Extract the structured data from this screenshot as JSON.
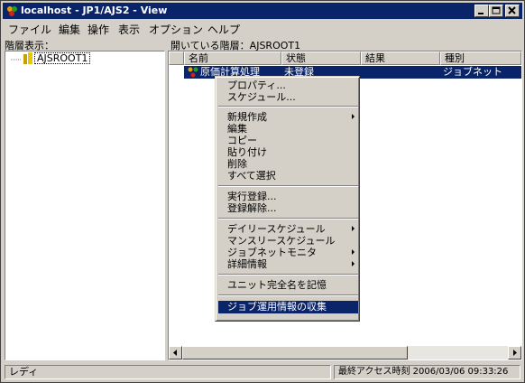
{
  "window": {
    "title": "localhost - JP1/AJS2 - View"
  },
  "menubar": [
    "ファイル",
    "編集",
    "操作",
    "表示",
    "オプション",
    "ヘルプ"
  ],
  "left_pane": {
    "header": "階層表示：",
    "tree_root": "AJSROOT1"
  },
  "right_pane": {
    "header": "開いている階層：AJSROOT1",
    "columns": [
      "名前",
      "状態",
      "結果",
      "種別"
    ],
    "rows": [
      {
        "name": "原価計算処理",
        "status": "未登録",
        "result": "",
        "type": "ジョブネット"
      }
    ]
  },
  "context_menu": {
    "items": [
      "プロパティ...",
      "スケジュール...",
      "新規作成",
      "編集",
      "コピー",
      "貼り付け",
      "削除",
      "すべて選択",
      "実行登録...",
      "登録解除...",
      "デイリースケジュール",
      "マンスリースケジュール",
      "ジョブネットモニタ",
      "詳細情報",
      "ユニット完全名を記憶",
      "ジョブ運用情報の収集"
    ],
    "highlighted": "ジョブ運用情報の収集"
  },
  "statusbar": {
    "left": "レディ",
    "right": "最終アクセス時刻 2006/03/06 09:33:26"
  }
}
